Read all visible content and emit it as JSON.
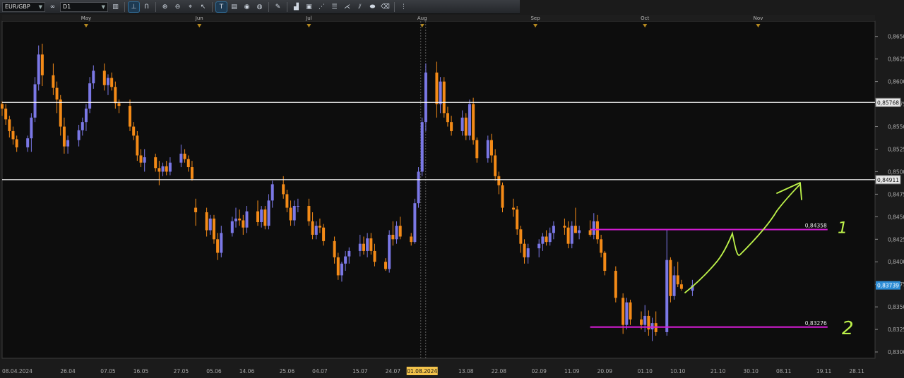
{
  "toolbar": {
    "symbol": "EUR/GBP",
    "chart_type_icon": "chain-link-icon",
    "timeframe": "D1",
    "tools": [
      "bar-chart-icon",
      "line-study-icon",
      "magnet-icon",
      "zoom-in-icon",
      "zoom-out-icon",
      "crosshair-icon",
      "cursor-icon",
      "text-tool-icon",
      "note-icon",
      "camera-icon",
      "globe-icon",
      "pencil-icon",
      "volume-icon",
      "window-icon",
      "gann-fan-icon",
      "fibonacci-icon",
      "pitchfork-icon",
      "channel-icon",
      "ellipse-icon",
      "eraser-icon",
      "more-icon"
    ]
  },
  "colors": {
    "background": "#0d0d0d",
    "bull": "#7b78e6",
    "bear": "#f38a17",
    "level_line": "#ffffff",
    "zone_line": "#d51cd5",
    "marker": "#b5891f",
    "forecast": "#bdf24a",
    "current_price_bg": "#2d8dd6"
  },
  "axis": {
    "month_labels": [
      "May",
      "Jun",
      "Jul",
      "Aug",
      "Sep",
      "Oct",
      "Nov"
    ],
    "date_labels": [
      "08.04.2024",
      "26.04",
      "07.05",
      "16.05",
      "27.05",
      "05.06",
      "14.06",
      "25.06",
      "04.07",
      "15.07",
      "24.07",
      "01.08.2024",
      "13.08",
      "22.08",
      "02.09",
      "11.09",
      "20.09",
      "01.10",
      "10.10",
      "21.10",
      "30.10",
      "08.11",
      "19.11",
      "28.11"
    ],
    "highlighted_date": "01.08.2024",
    "price_labels": [
      "0,8650",
      "0,8625",
      "0,8600",
      "0,8575",
      "0,8550",
      "0,8525",
      "0,8500",
      "0,8475",
      "0,8450",
      "0,8425",
      "0,8400",
      "0,8375",
      "0,8350",
      "0,8325",
      "0,8300"
    ]
  },
  "levels": [
    {
      "kind": "horizontal",
      "value": 0.85768,
      "label": "0,85768"
    },
    {
      "kind": "horizontal",
      "value": 0.84911,
      "label": "0,84911"
    }
  ],
  "zones": [
    {
      "value": 0.84358,
      "label": "0,84358",
      "annotation": "1"
    },
    {
      "value": 0.83276,
      "label": "0,83276",
      "annotation": "2"
    }
  ],
  "current_price": "0,83739",
  "chart_data": {
    "type": "candlestick",
    "symbol": "EUR/GBP",
    "timeframe": "D1",
    "ylim": [
      0.8293,
      0.8667
    ],
    "xlim": [
      "2024-04-08",
      "2024-12-03"
    ],
    "grid": false,
    "ohlc": [
      [
        "2024-04-08",
        0.8575,
        0.8578,
        0.8562,
        0.857
      ],
      [
        "2024-04-09",
        0.857,
        0.8575,
        0.8552,
        0.8558
      ],
      [
        "2024-04-10",
        0.8558,
        0.8562,
        0.8538,
        0.8545
      ],
      [
        "2024-04-11",
        0.8545,
        0.855,
        0.853,
        0.8536
      ],
      [
        "2024-04-12",
        0.8536,
        0.854,
        0.8522,
        0.8527
      ],
      [
        "2024-04-15",
        0.8527,
        0.854,
        0.8522,
        0.8537
      ],
      [
        "2024-04-16",
        0.8537,
        0.8565,
        0.8522,
        0.856
      ],
      [
        "2024-04-17",
        0.856,
        0.8605,
        0.8555,
        0.8597
      ],
      [
        "2024-04-18",
        0.8597,
        0.864,
        0.859,
        0.863
      ],
      [
        "2024-04-19",
        0.863,
        0.8642,
        0.8595,
        0.8607
      ],
      [
        "2024-04-22",
        0.8607,
        0.862,
        0.8585,
        0.8593
      ],
      [
        "2024-04-23",
        0.8593,
        0.86,
        0.8565,
        0.858
      ],
      [
        "2024-04-24",
        0.858,
        0.8585,
        0.854,
        0.855
      ],
      [
        "2024-04-25",
        0.855,
        0.856,
        0.852,
        0.8528
      ],
      [
        "2024-04-26",
        0.8528,
        0.854,
        0.852,
        0.8535
      ],
      [
        "2024-04-29",
        0.8535,
        0.8552,
        0.8528,
        0.8546
      ],
      [
        "2024-04-30",
        0.8546,
        0.856,
        0.854,
        0.8555
      ],
      [
        "2024-05-01",
        0.8555,
        0.8575,
        0.8545,
        0.857
      ],
      [
        "2024-05-02",
        0.857,
        0.8605,
        0.8565,
        0.8598
      ],
      [
        "2024-05-03",
        0.8598,
        0.8618,
        0.8592,
        0.8612
      ],
      [
        "2024-05-06",
        0.8612,
        0.862,
        0.859,
        0.8596
      ],
      [
        "2024-05-07",
        0.8596,
        0.8608,
        0.8585,
        0.8604
      ],
      [
        "2024-05-08",
        0.8604,
        0.861,
        0.859,
        0.8594
      ],
      [
        "2024-05-09",
        0.8594,
        0.86,
        0.857,
        0.8576
      ],
      [
        "2024-05-10",
        0.8576,
        0.858,
        0.8565,
        0.8573
      ],
      [
        "2024-05-13",
        0.8573,
        0.858,
        0.8545,
        0.855
      ],
      [
        "2024-05-14",
        0.855,
        0.8555,
        0.8535,
        0.854
      ],
      [
        "2024-05-15",
        0.854,
        0.8545,
        0.8512,
        0.8518
      ],
      [
        "2024-05-16",
        0.8518,
        0.8525,
        0.8505,
        0.851
      ],
      [
        "2024-05-17",
        0.851,
        0.8525,
        0.85,
        0.8516
      ],
      [
        "2024-05-20",
        0.8516,
        0.852,
        0.85,
        0.8504
      ],
      [
        "2024-05-21",
        0.8504,
        0.8512,
        0.8485,
        0.85
      ],
      [
        "2024-05-22",
        0.85,
        0.851,
        0.8495,
        0.8506
      ],
      [
        "2024-05-23",
        0.8506,
        0.8512,
        0.8496,
        0.85
      ],
      [
        "2024-05-24",
        0.85,
        0.8516,
        0.8496,
        0.851
      ],
      [
        "2024-05-27",
        0.851,
        0.853,
        0.8505,
        0.852
      ],
      [
        "2024-05-28",
        0.852,
        0.8525,
        0.851,
        0.8514
      ],
      [
        "2024-05-29",
        0.8514,
        0.8518,
        0.85,
        0.8505
      ],
      [
        "2024-05-30",
        0.8505,
        0.8512,
        0.849,
        0.8492
      ],
      [
        "2024-05-31",
        0.846,
        0.847,
        0.844,
        0.8455
      ],
      [
        "2024-06-03",
        0.8455,
        0.846,
        0.8428,
        0.8435
      ],
      [
        "2024-06-04",
        0.8435,
        0.8452,
        0.843,
        0.8448
      ],
      [
        "2024-06-05",
        0.8448,
        0.8452,
        0.842,
        0.8425
      ],
      [
        "2024-06-06",
        0.8425,
        0.8432,
        0.8402,
        0.841
      ],
      [
        "2024-06-07",
        0.841,
        0.844,
        0.8405,
        0.8432
      ],
      [
        "2024-06-10",
        0.8432,
        0.845,
        0.8428,
        0.8445
      ],
      [
        "2024-06-11",
        0.8445,
        0.846,
        0.8438,
        0.8448
      ],
      [
        "2024-06-12",
        0.8448,
        0.8458,
        0.844,
        0.8446
      ],
      [
        "2024-06-13",
        0.8446,
        0.8452,
        0.843,
        0.8438
      ],
      [
        "2024-06-14",
        0.8438,
        0.8462,
        0.8432,
        0.8456
      ],
      [
        "2024-06-17",
        0.8456,
        0.8468,
        0.844,
        0.8444
      ],
      [
        "2024-06-18",
        0.8444,
        0.8462,
        0.8438,
        0.8458
      ],
      [
        "2024-06-19",
        0.8458,
        0.8462,
        0.8436,
        0.844
      ],
      [
        "2024-06-20",
        0.844,
        0.8475,
        0.8436,
        0.8468
      ],
      [
        "2024-06-21",
        0.8468,
        0.849,
        0.846,
        0.8486
      ],
      [
        "2024-06-24",
        0.8486,
        0.8495,
        0.847,
        0.8475
      ],
      [
        "2024-06-25",
        0.8475,
        0.848,
        0.8455,
        0.846
      ],
      [
        "2024-06-26",
        0.846,
        0.8468,
        0.844,
        0.8446
      ],
      [
        "2024-06-27",
        0.8446,
        0.8468,
        0.844,
        0.8462
      ],
      [
        "2024-06-28",
        0.8462,
        0.847,
        0.8455,
        0.8462
      ],
      [
        "2024-07-01",
        0.8462,
        0.847,
        0.844,
        0.8445
      ],
      [
        "2024-07-02",
        0.8445,
        0.8455,
        0.8425,
        0.843
      ],
      [
        "2024-07-03",
        0.843,
        0.8445,
        0.8425,
        0.844
      ],
      [
        "2024-07-04",
        0.844,
        0.8448,
        0.8432,
        0.8438
      ],
      [
        "2024-07-05",
        0.8438,
        0.8442,
        0.8418,
        0.8423
      ],
      [
        "2024-07-08",
        0.8423,
        0.8428,
        0.8398,
        0.8405
      ],
      [
        "2024-07-09",
        0.8405,
        0.841,
        0.838,
        0.8385
      ],
      [
        "2024-07-10",
        0.8385,
        0.84,
        0.8378,
        0.8398
      ],
      [
        "2024-07-11",
        0.8398,
        0.8412,
        0.839,
        0.8406
      ],
      [
        "2024-07-12",
        0.8406,
        0.8416,
        0.8398,
        0.8412
      ],
      [
        "2024-07-15",
        0.8412,
        0.843,
        0.8406,
        0.842
      ],
      [
        "2024-07-16",
        0.842,
        0.8428,
        0.8408,
        0.8412
      ],
      [
        "2024-07-17",
        0.8412,
        0.8432,
        0.8405,
        0.8426
      ],
      [
        "2024-07-18",
        0.8426,
        0.8432,
        0.8408,
        0.8412
      ],
      [
        "2024-07-19",
        0.8412,
        0.842,
        0.8395,
        0.84
      ],
      [
        "2024-07-22",
        0.84,
        0.8404,
        0.839,
        0.8392
      ],
      [
        "2024-07-23",
        0.8392,
        0.8435,
        0.8388,
        0.843
      ],
      [
        "2024-07-24",
        0.843,
        0.8445,
        0.8418,
        0.8425
      ],
      [
        "2024-07-25",
        0.8425,
        0.8445,
        0.842,
        0.844
      ],
      [
        "2024-07-26",
        0.844,
        0.845,
        0.8425,
        0.8428
      ],
      [
        "2024-07-29",
        0.8428,
        0.8432,
        0.8418,
        0.8422
      ],
      [
        "2024-07-30",
        0.8422,
        0.847,
        0.842,
        0.8465
      ],
      [
        "2024-07-31",
        0.8465,
        0.8505,
        0.846,
        0.85
      ],
      [
        "2024-08-01",
        0.85,
        0.856,
        0.8495,
        0.8555
      ],
      [
        "2024-08-02",
        0.8555,
        0.862,
        0.8545,
        0.861
      ],
      [
        "2024-08-05",
        0.861,
        0.8622,
        0.856,
        0.8575
      ],
      [
        "2024-08-06",
        0.8575,
        0.8605,
        0.8565,
        0.86
      ],
      [
        "2024-08-07",
        0.86,
        0.8605,
        0.856,
        0.8565
      ],
      [
        "2024-08-08",
        0.8565,
        0.8572,
        0.855,
        0.8555
      ],
      [
        "2024-08-09",
        0.8555,
        0.8562,
        0.854,
        0.8545
      ],
      [
        "2024-08-12",
        0.8545,
        0.8568,
        0.854,
        0.856
      ],
      [
        "2024-08-13",
        0.856,
        0.8565,
        0.8535,
        0.854
      ],
      [
        "2024-08-14",
        0.854,
        0.858,
        0.8535,
        0.8575
      ],
      [
        "2024-08-15",
        0.8575,
        0.8582,
        0.853,
        0.8535
      ],
      [
        "2024-08-16",
        0.8535,
        0.8538,
        0.851,
        0.8515
      ],
      [
        "2024-08-19",
        0.8515,
        0.854,
        0.851,
        0.8535
      ],
      [
        "2024-08-20",
        0.8535,
        0.8542,
        0.851,
        0.8518
      ],
      [
        "2024-08-21",
        0.8518,
        0.8525,
        0.849,
        0.8495
      ],
      [
        "2024-08-22",
        0.8495,
        0.85,
        0.8475,
        0.8485
      ],
      [
        "2024-08-23",
        0.8485,
        0.8488,
        0.8455,
        0.846
      ],
      [
        "2024-08-26",
        0.846,
        0.847,
        0.845,
        0.8458
      ],
      [
        "2024-08-27",
        0.8458,
        0.8462,
        0.843,
        0.8436
      ],
      [
        "2024-08-28",
        0.8436,
        0.844,
        0.841,
        0.842
      ],
      [
        "2024-08-29",
        0.842,
        0.8425,
        0.8398,
        0.8405
      ],
      [
        "2024-08-30",
        0.8405,
        0.842,
        0.8398,
        0.8415
      ],
      [
        "2024-09-02",
        0.8415,
        0.8425,
        0.8405,
        0.842
      ],
      [
        "2024-09-03",
        0.842,
        0.8432,
        0.8412,
        0.8428
      ],
      [
        "2024-09-04",
        0.8428,
        0.8435,
        0.8418,
        0.8422
      ],
      [
        "2024-09-05",
        0.8422,
        0.8438,
        0.8418,
        0.8432
      ],
      [
        "2024-09-06",
        0.8432,
        0.8445,
        0.8425,
        0.844
      ],
      [
        "2024-09-09",
        0.844,
        0.8448,
        0.843,
        0.8438
      ],
      [
        "2024-09-10",
        0.8438,
        0.8445,
        0.8415,
        0.842
      ],
      [
        "2024-09-11",
        0.842,
        0.8445,
        0.8415,
        0.844
      ],
      [
        "2024-09-12",
        0.844,
        0.846,
        0.8432,
        0.8432
      ],
      [
        "2024-09-13",
        0.8432,
        0.844,
        0.8425,
        0.8435
      ],
      [
        "2024-09-16",
        0.8435,
        0.8446,
        0.8428,
        0.843
      ],
      [
        "2024-09-17",
        0.843,
        0.8454,
        0.8425,
        0.8445
      ],
      [
        "2024-09-18",
        0.8445,
        0.8452,
        0.842,
        0.8425
      ],
      [
        "2024-09-19",
        0.8425,
        0.843,
        0.8405,
        0.841
      ],
      [
        "2024-09-20",
        0.841,
        0.8412,
        0.8385,
        0.839
      ],
      [
        "2024-09-23",
        0.839,
        0.8395,
        0.8355,
        0.836
      ],
      [
        "2024-09-25",
        0.836,
        0.8365,
        0.832,
        0.833
      ],
      [
        "2024-09-26",
        0.833,
        0.836,
        0.8325,
        0.8355
      ],
      [
        "2024-09-27",
        0.8355,
        0.8358,
        0.833,
        0.8336
      ],
      [
        "2024-09-30",
        0.8336,
        0.8345,
        0.8325,
        0.833
      ],
      [
        "2024-10-01",
        0.833,
        0.8352,
        0.8322,
        0.834
      ],
      [
        "2024-10-02",
        0.834,
        0.8346,
        0.8318,
        0.8325
      ],
      [
        "2024-10-03",
        0.8325,
        0.8338,
        0.8312,
        0.8332
      ],
      [
        "2024-10-04",
        0.8332,
        0.8345,
        0.8318,
        0.8322
      ],
      [
        "2024-10-07",
        0.8322,
        0.8435,
        0.8318,
        0.8402
      ],
      [
        "2024-10-08",
        0.8402,
        0.8405,
        0.8355,
        0.8362
      ],
      [
        "2024-10-09",
        0.8362,
        0.8395,
        0.8358,
        0.8385
      ],
      [
        "2024-10-10",
        0.8385,
        0.84,
        0.8372,
        0.8375
      ],
      [
        "2024-10-11",
        0.8375,
        0.838,
        0.8368,
        0.837
      ],
      [
        "2024-10-14",
        0.8368,
        0.838,
        0.8362,
        0.8374
      ]
    ]
  }
}
